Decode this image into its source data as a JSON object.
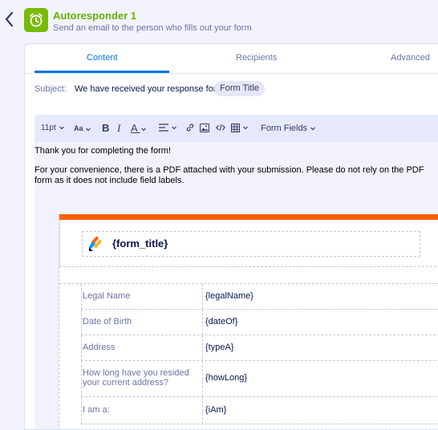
{
  "header": {
    "title": "Autoresponder 1",
    "subtitle": "Send an email to the person who fills out your form"
  },
  "tabs": [
    {
      "label": "Content",
      "active": true
    },
    {
      "label": "Recipients",
      "active": false
    },
    {
      "label": "Advanced",
      "active": false
    }
  ],
  "subject": {
    "label": "Subject:",
    "text": "We have received your response for",
    "chip": "Form Title"
  },
  "toolbar": {
    "font_size": "11pt",
    "text_size_label": "Aa",
    "bold": "B",
    "italic": "I",
    "color_label": "A",
    "form_fields": "Form Fields"
  },
  "body": {
    "line1": "Thank you for completing the form!",
    "line2": "For your convenience, there is a PDF attached with your submission. Please do not rely on the PDF",
    "line3": "form as it does not include field labels."
  },
  "email": {
    "form_title": "{form_title}",
    "rows": [
      {
        "label": "Legal Name",
        "value": "{legalName}"
      },
      {
        "label": "Date of Birth",
        "value": "{dateOf}"
      },
      {
        "label": "Address",
        "value": "{typeA}"
      },
      {
        "label": "How long have you resided your current address?",
        "value": "{howLong}"
      },
      {
        "label": "I am a:",
        "value": "{iAm}"
      }
    ]
  },
  "colors": {
    "accent": "#0075e3",
    "brand_green": "#78bb07",
    "email_bar": "#ff6100"
  }
}
